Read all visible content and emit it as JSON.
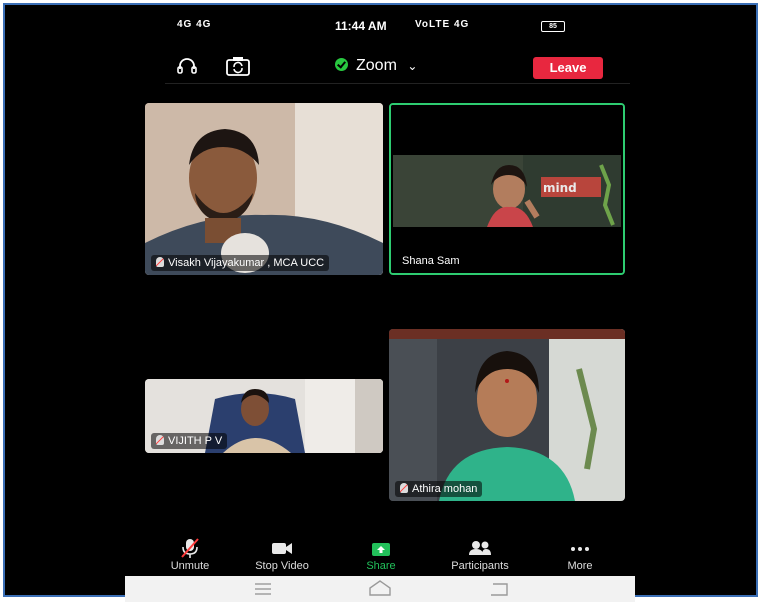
{
  "status_bar": {
    "left_icons": "4G 4G",
    "time": "11:44 AM",
    "right_icons": "VoLTE 4G",
    "battery": "85"
  },
  "top_bar": {
    "meeting_title": "Zoom",
    "leave_label": "Leave"
  },
  "participants": [
    {
      "name": "Visakh Vijayakumar , MCA UCC",
      "muted": true,
      "active_speaker": false
    },
    {
      "name": "Shana Sam",
      "muted": false,
      "active_speaker": true
    },
    {
      "name": "VIJITH P V",
      "muted": true,
      "active_speaker": false
    },
    {
      "name": "Athira mohan",
      "muted": true,
      "active_speaker": false
    }
  ],
  "bottom_bar": {
    "unmute": "Unmute",
    "stop_video": "Stop Video",
    "share": "Share",
    "participants": "Participants",
    "more": "More"
  },
  "colors": {
    "leave": "#e8273f",
    "share": "#22c05a",
    "active_border": "#2ecc71"
  }
}
